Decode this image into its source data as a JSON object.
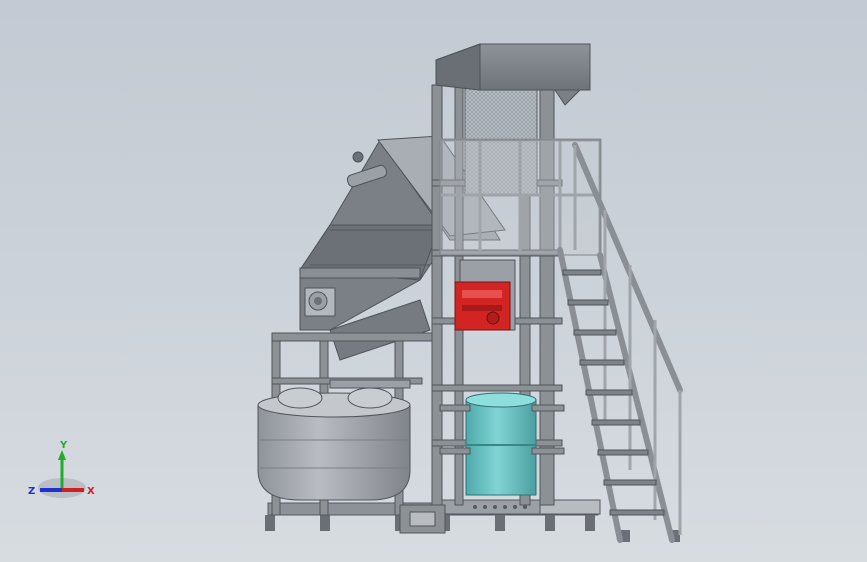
{
  "app": {
    "view": "3d-cad-model-view"
  },
  "triad": {
    "x_label": "X",
    "y_label": "Y",
    "z_label": "Z",
    "colors": {
      "x": "#d11f1f",
      "y": "#1fae2c",
      "z": "#1f2fd1"
    }
  },
  "model": {
    "description_icon": "industrial-machine-model",
    "colors": {
      "frame": "#8c9196",
      "frame_dark": "#5f6469",
      "hopper": "#7b8086",
      "tank": "#a4a8ae",
      "drum": "#6fc6c6",
      "motor": "#d32424",
      "mesh": "#b9bfc6"
    }
  }
}
